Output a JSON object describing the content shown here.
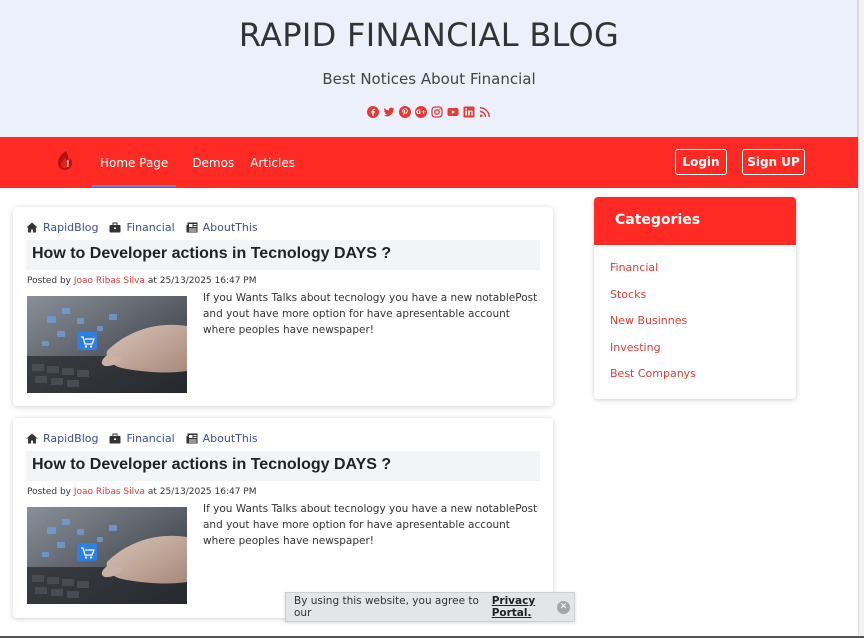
{
  "header": {
    "title": "RAPID FINANCIAL BLOG",
    "subtitle": "Best Notices About Financial",
    "social_icons": [
      "facebook-icon",
      "twitter-icon",
      "pinterest-icon",
      "google-plus-icon",
      "instagram-icon",
      "youtube-icon",
      "linkedin-icon",
      "rss-icon"
    ],
    "social_color": "#e53935",
    "background": "#ebf0fa"
  },
  "nav": {
    "background": "#ff2a24",
    "logo_icon": "flame-logo-icon",
    "links": [
      "Home Page",
      "Demos",
      "Articles"
    ],
    "active_link": "Home Page",
    "login_label": "Login",
    "signup_label": "Sign UP"
  },
  "posts": [
    {
      "breadcrumbs": [
        {
          "icon": "home-icon",
          "label": "RapidBlog"
        },
        {
          "icon": "briefcase-icon",
          "label": "Financial"
        },
        {
          "icon": "newspaper-icon",
          "label": "AboutThis"
        }
      ],
      "title": "How to Developer actions in Tecnology DAYS ?",
      "posted_by_label": "Posted by",
      "author": "Joao Ribas Silva",
      "date_text": "at 25/13/2025 16:47 PM",
      "excerpt": "If you Wants Talks about tecnology you have a new notablePost and yout have more option for have apresentable account where peoples have newspaper!",
      "thumbnail": "online-shopping-keyboard-image"
    },
    {
      "breadcrumbs": [
        {
          "icon": "home-icon",
          "label": "RapidBlog"
        },
        {
          "icon": "briefcase-icon",
          "label": "Financial"
        },
        {
          "icon": "newspaper-icon",
          "label": "AboutThis"
        }
      ],
      "title": "How to Developer actions in Tecnology DAYS ?",
      "posted_by_label": "Posted by",
      "author": "Joao Ribas Silva",
      "date_text": "at 25/13/2025 16:47 PM",
      "excerpt": "If you Wants Talks about tecnology you have a new notablePost and yout have more option for have apresentable account where peoples have newspaper!",
      "thumbnail": "online-shopping-keyboard-image"
    }
  ],
  "sidebar": {
    "header": "Categories",
    "items": [
      "Financial",
      "Stocks",
      "New Businnes",
      "Investing",
      "Best Companys"
    ]
  },
  "cookie": {
    "text": "By using this website, you agree to our",
    "link": "Privacy Portal."
  },
  "colors": {
    "accent": "#ff2a24",
    "link_blue": "#3b4b9a",
    "author_red": "#e53935"
  }
}
